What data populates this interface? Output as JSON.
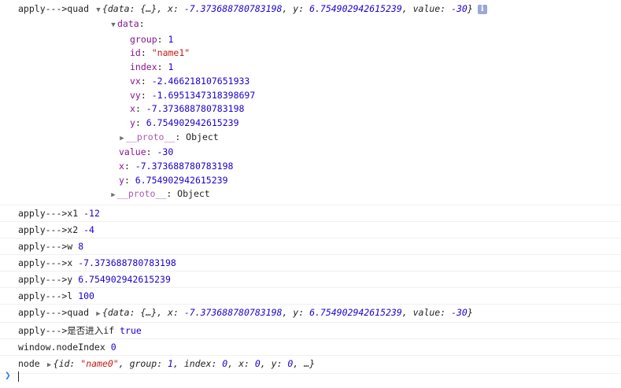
{
  "console": {
    "quad_expanded": {
      "prefix": "apply--->quad",
      "summary_open": "{data: {…}, x: ",
      "summary_x": "-7.373688780783198",
      "summary_y_label": ", y: ",
      "summary_y": "6.754902942615239",
      "summary_value_label": ", value: ",
      "summary_value": "-30",
      "summary_close": "}",
      "data_label": "data",
      "data_props": [
        {
          "key": "group",
          "val": "1",
          "type": "num"
        },
        {
          "key": "id",
          "val": "\"name1\"",
          "type": "str"
        },
        {
          "key": "index",
          "val": "1",
          "type": "num"
        },
        {
          "key": "vx",
          "val": "-2.466218107651933",
          "type": "num"
        },
        {
          "key": "vy",
          "val": "-1.6951347318398697",
          "type": "num"
        },
        {
          "key": "x",
          "val": "-7.373688780783198",
          "type": "num"
        },
        {
          "key": "y",
          "val": "6.754902942615239",
          "type": "num"
        }
      ],
      "data_proto_key": "__proto__",
      "data_proto_val": "Object",
      "props": [
        {
          "key": "value",
          "val": "-30"
        },
        {
          "key": "x",
          "val": "-7.373688780783198"
        },
        {
          "key": "y",
          "val": "6.754902942615239"
        }
      ],
      "proto_key": "__proto__",
      "proto_val": "Object"
    },
    "simple_logs": [
      {
        "label": "apply--->x1",
        "value": "-12"
      },
      {
        "label": "apply--->x2",
        "value": "-4"
      },
      {
        "label": "apply--->w",
        "value": "8"
      },
      {
        "label": "apply--->x",
        "value": "-7.373688780783198"
      },
      {
        "label": "apply--->y",
        "value": "6.754902942615239"
      },
      {
        "label": "apply--->l",
        "value": "100"
      }
    ],
    "quad_collapsed": {
      "prefix": "apply--->quad",
      "open": "{data: {…}, x: ",
      "x": "-7.373688780783198",
      "y_label": ", y: ",
      "y": "6.754902942615239",
      "value_label": ", value: ",
      "value": "-30",
      "close": "}"
    },
    "if_log": {
      "label": "apply--->是否进入if",
      "value": "true"
    },
    "node_index_log": {
      "label": "window.nodeIndex",
      "value": "0"
    },
    "node_log": {
      "label": "node",
      "open": "{id: ",
      "id": "\"name0\"",
      "group_label": ", group: ",
      "group": "1",
      "index_label": ", index: ",
      "index": "0",
      "x_label": ", x: ",
      "x": "0",
      "y_label": ", y: ",
      "y": "0",
      "close": ", …}"
    },
    "prompt_icon": "chevron-right-icon",
    "info_icon": "info-icon"
  }
}
